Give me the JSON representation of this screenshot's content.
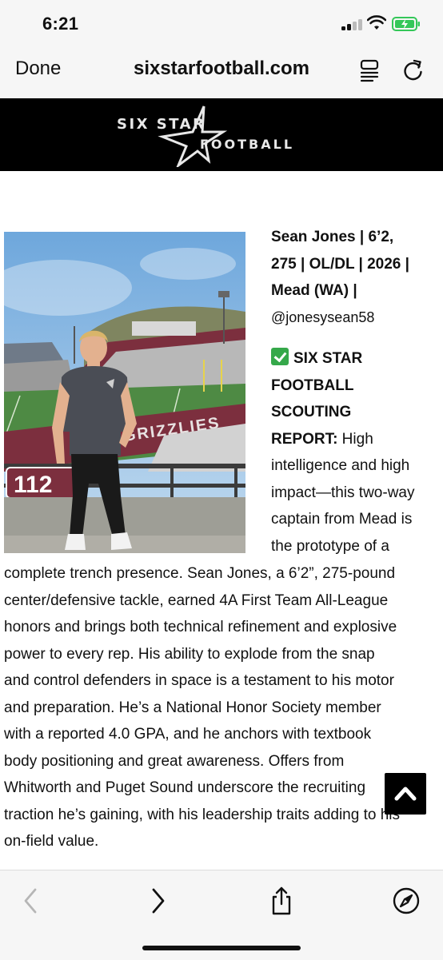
{
  "status_bar": {
    "time": "6:21",
    "battery_charging": true
  },
  "browser": {
    "done_label": "Done",
    "url": "sixstarfootball.com"
  },
  "site": {
    "logo_line1": "SIX STAR",
    "logo_line2": "FOOTBALL"
  },
  "article": {
    "headline_lines": [
      "Sean Jones | 6’2,",
      "275 | OL/DL | 2026 |",
      "Mead (WA) |"
    ],
    "handle": "@jonesysean58",
    "report_lines": [
      "SIX STAR",
      "FOOTBALL",
      "SCOUTING"
    ],
    "report_label": "REPORT:",
    "wrap_lines": [
      " High",
      "intelligence and high",
      "impact—this two-way",
      "captain from Mead is",
      "the prototype of a"
    ],
    "body_lines": [
      "complete trench presence. Sean Jones, a 6’2”, 275-pound",
      "center/defensive tackle, earned 4A First Team All-League",
      "honors and brings both technical refinement and explosive",
      "power to every rep. His ability to explode from the snap",
      "and control defenders in space is a testament to his motor",
      "and preparation. He’s a National Honor Society member",
      "with a reported 4.0 GPA, and he anchors with textbook",
      "body positioning and great awareness. Offers from",
      "Whitworth and Puget Sound underscore the recruiting",
      "traction he’s gaining, with his leadership traits adding to his",
      "on-field value."
    ],
    "photo_text": {
      "railing_number": "112",
      "stadium_lettering": "GRIZZLIES"
    }
  },
  "icons": {
    "reader": "reader-icon",
    "reload": "reload-icon",
    "back": "chevron-left-icon",
    "forward": "chevron-right-icon",
    "share": "share-icon",
    "safari": "compass-icon",
    "scroll_top": "chevron-up-icon",
    "check": "check-icon"
  },
  "colors": {
    "header_bg": "#000000",
    "check_green": "#35a84a",
    "battery_green": "#34c759",
    "toolbar_bg": "#f6f6f6"
  }
}
